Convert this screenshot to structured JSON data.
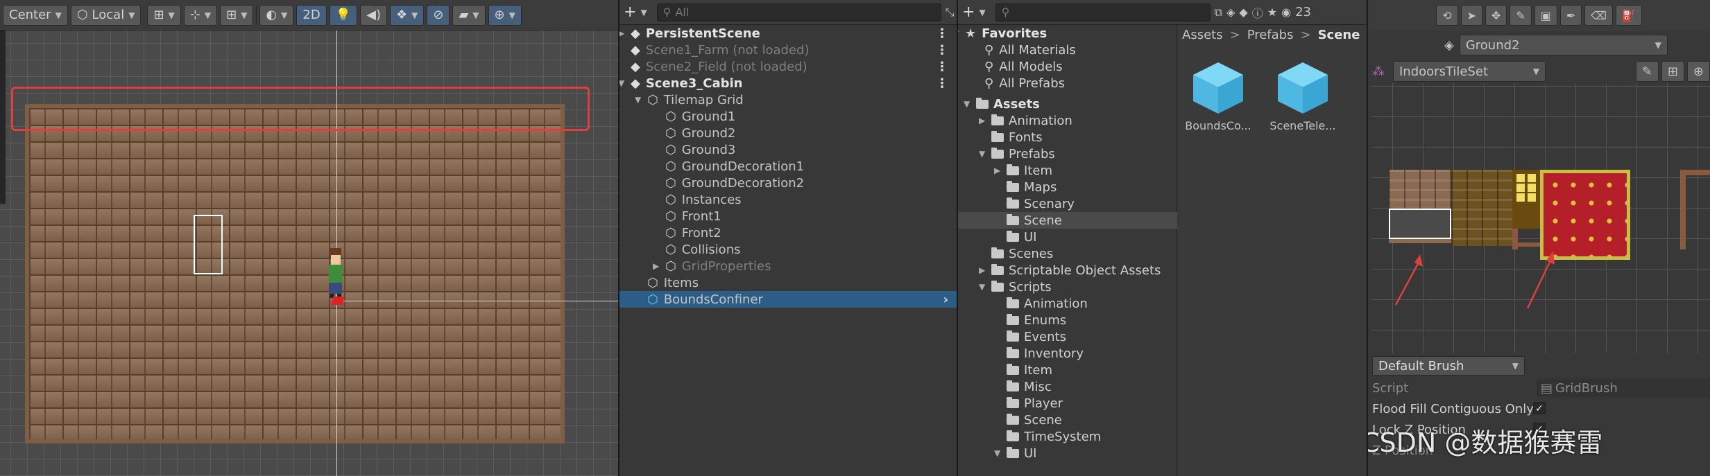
{
  "scene_toolbar": {
    "pivot": "Center",
    "space": "Local",
    "mode_2d": "2D"
  },
  "hierarchy": {
    "search_placeholder": "All",
    "items": [
      {
        "label": "PersistentScene"
      },
      {
        "label": "Scene1_Farm (not loaded)"
      },
      {
        "label": "Scene2_Field (not loaded)"
      },
      {
        "label": "Scene3_Cabin"
      },
      {
        "label": "Tilemap Grid"
      },
      {
        "label": "Ground1"
      },
      {
        "label": "Ground2"
      },
      {
        "label": "Ground3"
      },
      {
        "label": "GroundDecoration1"
      },
      {
        "label": "GroundDecoration2"
      },
      {
        "label": "Instances"
      },
      {
        "label": "Front1"
      },
      {
        "label": "Front2"
      },
      {
        "label": "Collisions"
      },
      {
        "label": "GridProperties"
      },
      {
        "label": "Items"
      },
      {
        "label": "BoundsConfiner"
      }
    ]
  },
  "project": {
    "hidden_count": "23",
    "favorites_label": "Favorites",
    "favorites": [
      "All Materials",
      "All Models",
      "All Prefabs"
    ],
    "assets_label": "Assets",
    "tree": [
      "Animation",
      "Fonts",
      "Prefabs",
      "Item",
      "Maps",
      "Scenary",
      "Scene",
      "UI",
      "Scenes",
      "Scriptable Object Assets",
      "Scripts",
      "Animation",
      "Enums",
      "Events",
      "Inventory",
      "Item",
      "Misc",
      "Player",
      "Scene",
      "TimeSystem",
      "UI"
    ],
    "breadcrumb": [
      "Assets",
      "Prefabs",
      "Scene"
    ],
    "assets_grid": [
      {
        "name": "BoundsCo..."
      },
      {
        "name": "SceneTele..."
      }
    ]
  },
  "palette": {
    "active_tilemap": "Ground2",
    "tileset": "IndoorsTileSet",
    "brush": "Default Brush",
    "props": {
      "script_label": "Script",
      "script_value": "GridBrush",
      "flood_fill_label": "Flood Fill Contiguous Only",
      "lock_z_label": "Lock Z Position",
      "z_position_label": "Z Position"
    }
  },
  "watermark": "CSDN @数据猴赛雷",
  "colors": {
    "selection": "#2c5d87",
    "annotation_red": "#e0403a",
    "asset_icon": "#5ac8f0"
  }
}
